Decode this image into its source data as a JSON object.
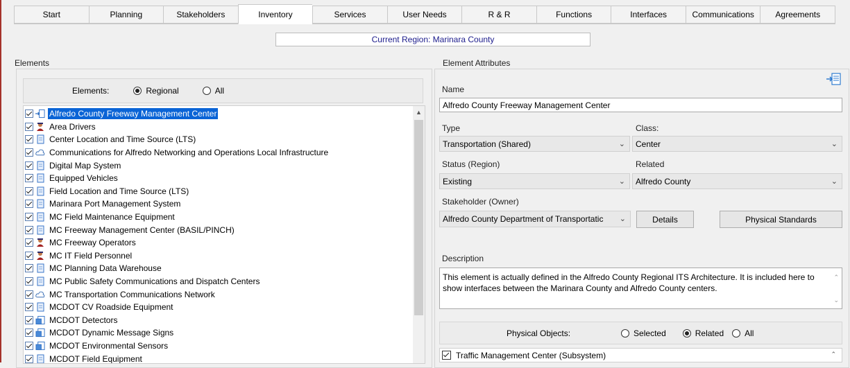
{
  "tabs": [
    {
      "label": "Start",
      "active": false
    },
    {
      "label": "Planning",
      "active": false
    },
    {
      "label": "Stakeholders",
      "active": false
    },
    {
      "label": "Inventory",
      "active": true
    },
    {
      "label": "Services",
      "active": false
    },
    {
      "label": "User Needs",
      "active": false
    },
    {
      "label": "R & R",
      "active": false
    },
    {
      "label": "Functions",
      "active": false
    },
    {
      "label": "Interfaces",
      "active": false
    },
    {
      "label": "Communications",
      "active": false
    },
    {
      "label": "Agreements",
      "active": false
    }
  ],
  "region": "Current Region: Marinara County",
  "elements_panel": {
    "title": "Elements",
    "filter_label": "Elements:",
    "radio_regional": "Regional",
    "radio_all": "All",
    "selected_filter": "regional",
    "items": [
      {
        "label": "Alfredo County Freeway Management Center",
        "icon": "arrow-doc-icon",
        "selected": true
      },
      {
        "label": "Area Drivers",
        "icon": "person-icon",
        "selected": false
      },
      {
        "label": "Center Location and Time Source (LTS)",
        "icon": "document-icon",
        "selected": false
      },
      {
        "label": "Communications for Alfredo Networking and Operations Local Infrastructure",
        "icon": "cloud-icon",
        "selected": false
      },
      {
        "label": "Digital Map System",
        "icon": "document-icon",
        "selected": false
      },
      {
        "label": "Equipped Vehicles",
        "icon": "document-icon",
        "selected": false
      },
      {
        "label": "Field Location and Time Source (LTS)",
        "icon": "document-icon",
        "selected": false
      },
      {
        "label": "Marinara Port Management System",
        "icon": "document-icon",
        "selected": false
      },
      {
        "label": "MC Field Maintenance Equipment",
        "icon": "document-icon",
        "selected": false
      },
      {
        "label": "MC Freeway Management Center (BASIL/PINCH)",
        "icon": "document-icon",
        "selected": false
      },
      {
        "label": "MC Freeway Operators",
        "icon": "person-icon",
        "selected": false
      },
      {
        "label": "MC IT Field Personnel",
        "icon": "person-icon",
        "selected": false
      },
      {
        "label": "MC Planning Data Warehouse",
        "icon": "document-icon",
        "selected": false
      },
      {
        "label": "MC Public Safety Communications and Dispatch Centers",
        "icon": "document-icon",
        "selected": false
      },
      {
        "label": "MC Transportation Communications Network",
        "icon": "cloud-icon",
        "selected": false
      },
      {
        "label": "MCDOT CV Roadside Equipment",
        "icon": "document-icon",
        "selected": false
      },
      {
        "label": "MCDOT Detectors",
        "icon": "stack-icon",
        "selected": false
      },
      {
        "label": "MCDOT Dynamic Message Signs",
        "icon": "stack-icon",
        "selected": false
      },
      {
        "label": "MCDOT Environmental Sensors",
        "icon": "stack-icon",
        "selected": false
      },
      {
        "label": "MCDOT Field Equipment",
        "icon": "document-icon",
        "selected": false
      }
    ]
  },
  "attributes": {
    "title": "Element Attributes",
    "export_icon": "export-icon",
    "name_label": "Name",
    "name_value": "Alfredo County Freeway Management Center",
    "type_label": "Type",
    "type_value": "Transportation (Shared)",
    "class_label": "Class:",
    "class_value": "Center",
    "status_label": "Status (Region)",
    "status_value": "Existing",
    "related_label": "Related",
    "related_value": "Alfredo County",
    "stakeholder_label": "Stakeholder (Owner)",
    "stakeholder_value": "Alfredo County Department of Transportatic",
    "details_button": "Details",
    "physical_standards_button": "Physical Standards",
    "description_label": "Description",
    "description_text": "This element is actually defined in the Alfredo County Regional ITS Architecture.  It is included here to show interfaces between the Marinara County and Alfredo County centers.",
    "physical_objects_label": "Physical Objects:",
    "radio_selected": "Selected",
    "radio_related": "Related",
    "radio_all": "All",
    "physical_filter": "related",
    "physical_objects": [
      {
        "label": "Traffic Management Center (Subsystem)",
        "checked": true
      }
    ]
  },
  "colors": {
    "accent": "#0a64d6",
    "region_text": "#1c1c8c",
    "window_bg": "#f0f0f0"
  }
}
